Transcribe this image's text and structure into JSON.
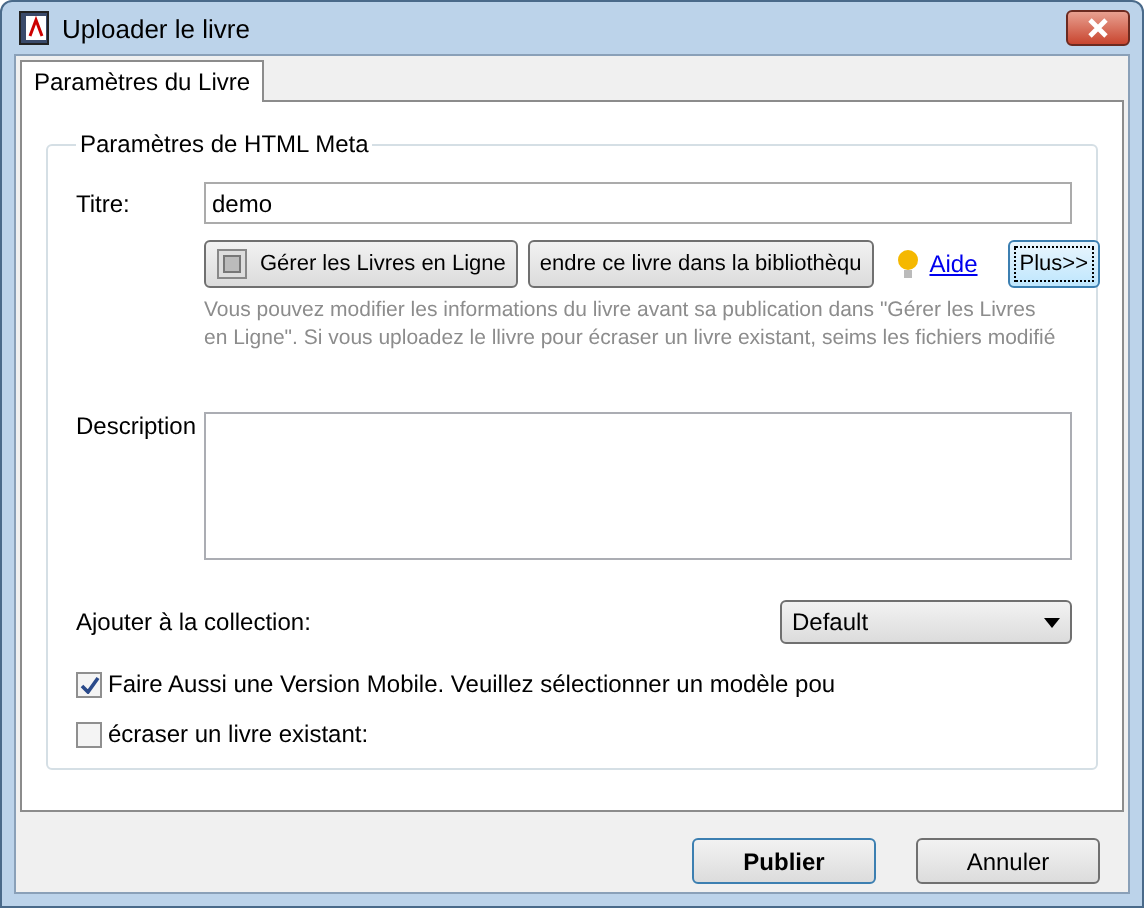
{
  "window": {
    "title": "Uploader le livre"
  },
  "tabs": [
    {
      "label": "Paramètres du Livre",
      "selected": true
    }
  ],
  "group": {
    "title": "Paramètres de HTML Meta"
  },
  "title_field": {
    "label": "Titre:",
    "value": "demo"
  },
  "actions": [
    {
      "kind": "icon-button",
      "label": "Gérer les Livres en Ligne"
    },
    {
      "kind": "button",
      "label": "endre ce livre dans la bibliothèqu"
    },
    {
      "kind": "link",
      "label": "Aide"
    },
    {
      "kind": "focused",
      "label": "Plus>>"
    }
  ],
  "info": [
    "Vous pouvez modifier les informations du livre avant sa publication dans \"Gérer les Livres",
    "en Ligne\". Si vous uploadez le llivre pour écraser un livre existant, seims les fichiers modifié"
  ],
  "description": {
    "label": "Description"
  },
  "collection": {
    "label": "Ajouter à la collection:",
    "value": "Default"
  },
  "options": [
    {
      "label": "Faire Aussi une Version Mobile. Veuillez sélectionner un modèle pou",
      "checked": true
    },
    {
      "label": "écraser un livre existant:",
      "checked": false
    }
  ],
  "buttons": [
    {
      "label": "Publier",
      "default": true
    },
    {
      "label": "Annuler",
      "default": false
    }
  ]
}
